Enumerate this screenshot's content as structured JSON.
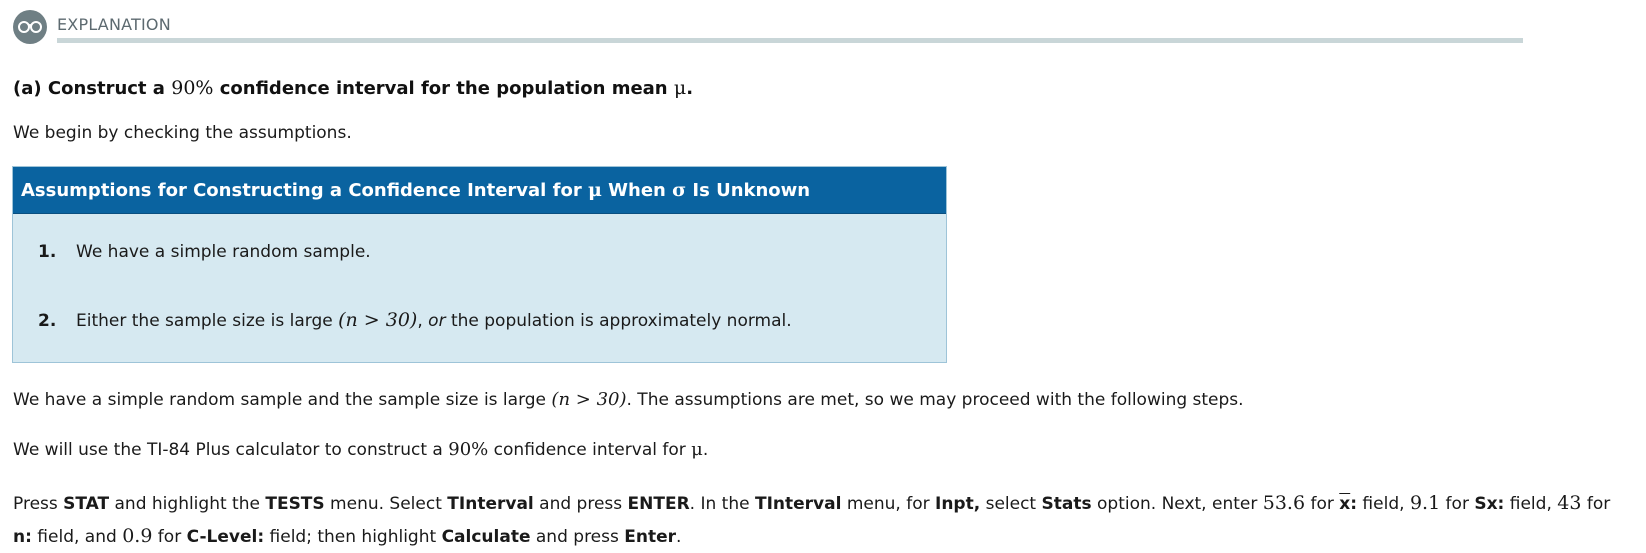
{
  "header": {
    "label": "EXPLANATION",
    "icon": "glasses-icon",
    "rule_color": "#c9d6d8"
  },
  "part_a": {
    "prefix": "(a) Construct a ",
    "percent": "90%",
    "middle": " confidence interval for the population mean ",
    "mu": "μ",
    "end": "."
  },
  "intro": "We begin by checking the assumptions.",
  "assumptions": {
    "title_prefix": "Assumptions for Constructing a Confidence Interval for ",
    "mu": "μ",
    "title_mid": " When ",
    "sigma": "σ",
    "title_suffix": " Is Unknown",
    "header_color": "#0a63a0",
    "body_color": "#d6e9f1",
    "items": [
      {
        "num": "1.",
        "text": "We have a simple random sample."
      },
      {
        "num": "2.",
        "pre": "Either the sample size is large ",
        "math": "(n > 30)",
        "comma": ", ",
        "or": "or",
        "post": " the population is approximately normal."
      }
    ]
  },
  "conclusion": {
    "pre": "We have a simple random sample and the sample size is large ",
    "math": "(n > 30)",
    "post": ". The assumptions are met, so we may proceed with the following steps."
  },
  "calc_intro": {
    "pre": "We will use the TI-84 Plus calculator to construct a ",
    "percent": "90%",
    "mid": " confidence interval for ",
    "mu": "μ",
    "end": "."
  },
  "instructions": {
    "t1": "Press ",
    "stat": "STAT",
    "t2": " and highlight the ",
    "tests": "TESTS",
    "t3": " menu. Select ",
    "tinterval": "TInterval",
    "t4": " and press ",
    "enter": "ENTER",
    "t5": ". In the ",
    "tinterval2": "TInterval",
    "t6": " menu, for ",
    "inpt": "Inpt,",
    "t7": " select ",
    "stats": "Stats",
    "t8": " option. Next, enter ",
    "xbar_val": "53.6",
    "t9": " for ",
    "xbar": "x",
    "xbar_colon": ":",
    "t10": " field, ",
    "sx_val": "9.1",
    "t11": " for ",
    "sx": "Sx:",
    "t12": " field, ",
    "n_val": "43",
    "t13": " for ",
    "n": "n:",
    "t14": " field, and ",
    "c_val": "0.9",
    "t15": " for ",
    "clevel": "C-Level:",
    "t16": " field; then highlight ",
    "calculate": "Calculate",
    "t17": " and press ",
    "enter2": "Enter",
    "t18": "."
  }
}
